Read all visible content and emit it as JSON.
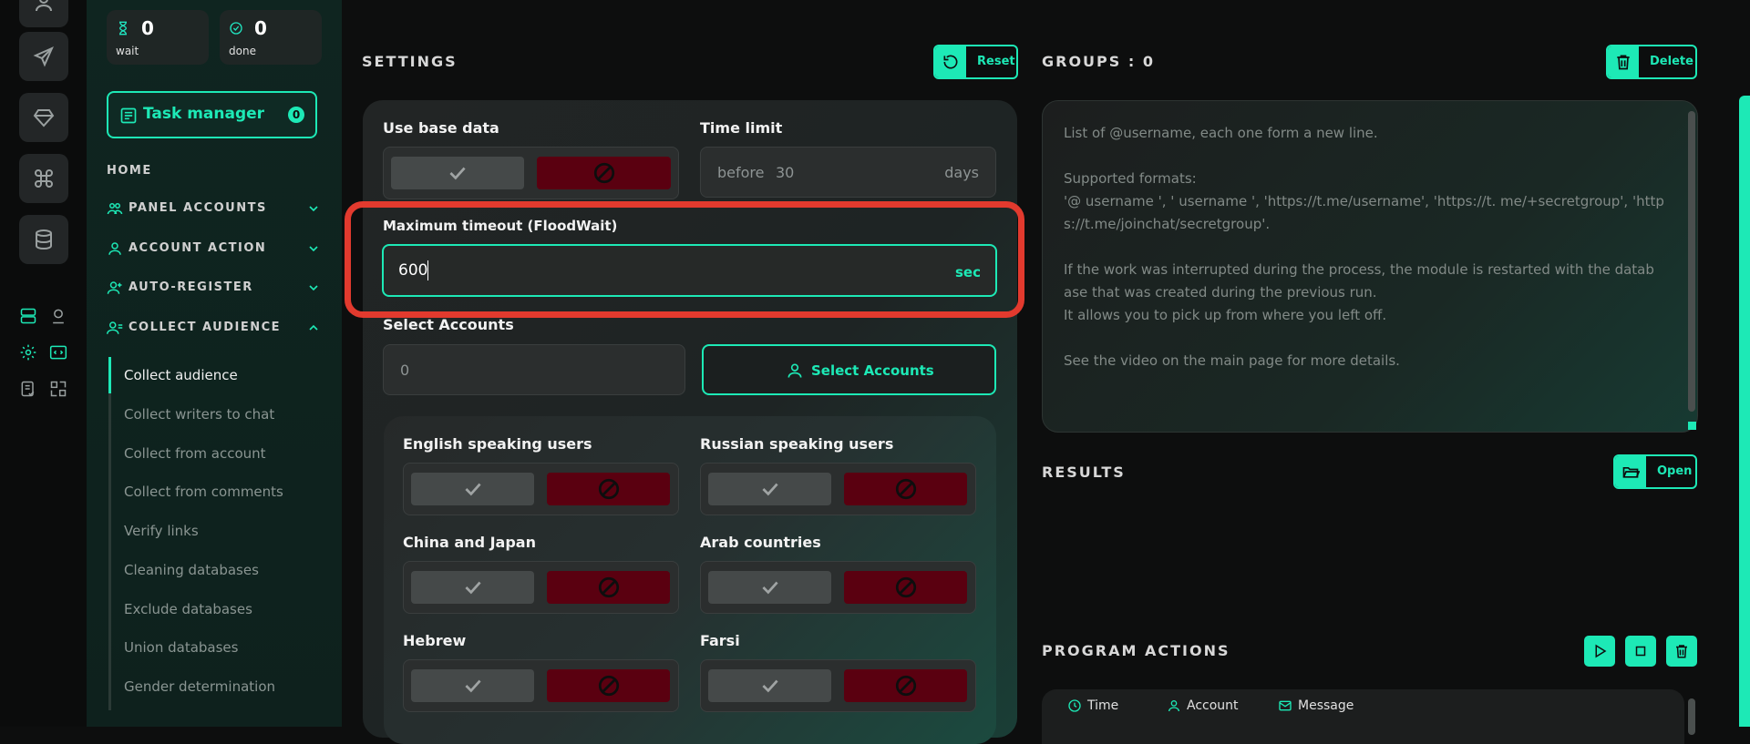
{
  "sidebar": {
    "wait": {
      "count": "0",
      "label": "wait"
    },
    "done": {
      "count": "0",
      "label": "done"
    },
    "task_manager": {
      "label": "Task manager",
      "badge": "0"
    },
    "home": "HOME",
    "sections": [
      {
        "label": "PANEL ACCOUNTS",
        "icon": "users-icon"
      },
      {
        "label": "ACCOUNT ACTION",
        "icon": "user-icon"
      },
      {
        "label": "AUTO-REGISTER",
        "icon": "user-plus-icon"
      },
      {
        "label": "COLLECT AUDIENCE",
        "icon": "user-list-icon"
      }
    ],
    "sub_items": [
      "Collect audience",
      "Collect writers to chat",
      "Collect from account",
      "Collect from comments",
      "Verify links",
      "Cleaning databases",
      "Exclude databases",
      "Union databases",
      "Gender determination"
    ]
  },
  "settings": {
    "title": "SETTINGS",
    "reset_label": "Reset",
    "use_base_data": "Use base data",
    "time_limit": {
      "label": "Time limit",
      "prefix": "before",
      "value": "30",
      "suffix": "days"
    },
    "max_timeout": {
      "label": "Maximum timeout (FloodWait)",
      "value": "600",
      "suffix": "sec"
    },
    "select_accounts": {
      "label": "Select Accounts",
      "count": "0",
      "button": "Select Accounts"
    },
    "languages": [
      "English speaking users",
      "Russian speaking users",
      "China and Japan",
      "Arab countries",
      "Hebrew",
      "Farsi"
    ]
  },
  "groups": {
    "title": "GROUPS : 0",
    "delete_label": "Delete",
    "placeholder_lines": [
      "List of @username, each one form a new line.",
      "",
      "Supported formats:",
      "'@ username ', ' username ', 'https://t.me/username', 'https://t. me/+secretgroup', 'http",
      "s://t.me/joinchat/secretgroup'.",
      "",
      "If the work was interrupted during the process, the module is restarted with the datab",
      "ase that was created during the previous run.",
      "It allows you to pick up from where you left off.",
      "",
      "See the video on the main page for more details."
    ]
  },
  "results": {
    "title": "RESULTS",
    "open_label": "Open"
  },
  "program_actions": {
    "title": "PROGRAM ACTIONS",
    "columns": [
      "Time",
      "Account",
      "Message"
    ]
  },
  "colors": {
    "accent": "#1de9b6",
    "danger": "#5a0010",
    "highlight": "#e23a2e"
  }
}
